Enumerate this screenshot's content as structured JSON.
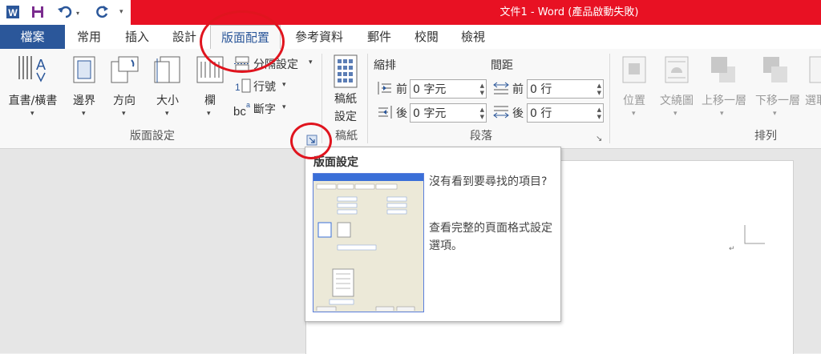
{
  "window": {
    "title": "文件1 - Word (產品啟動失敗)"
  },
  "tabs": [
    "檔案",
    "常用",
    "插入",
    "設計",
    "版面配置",
    "參考資料",
    "郵件",
    "校閱",
    "檢視"
  ],
  "page_setup": {
    "text_direction": "直書/橫書",
    "margins": "邊界",
    "orientation": "方向",
    "size": "大小",
    "columns": "欄",
    "breaks": "分隔設定",
    "line_numbers": "行號",
    "hyphenation": "斷字",
    "group_label": "版面設定"
  },
  "draft": {
    "label_line1": "稿紙",
    "label_line2": "設定",
    "group_label": "稿紙"
  },
  "paragraph": {
    "indent_title": "縮排",
    "spacing_title": "間距",
    "indent_before_label": "前",
    "indent_after_label": "後",
    "indent_before_value": "0 字元",
    "indent_after_value": "0 字元",
    "spacing_before_label": "前",
    "spacing_after_label": "後",
    "spacing_before_value": "0 行",
    "spacing_after_value": "0 行",
    "group_label": "段落"
  },
  "arrange": {
    "position": "位置",
    "wrap_text": "文繞圖",
    "bring_forward": "上移一層",
    "send_backward": "下移一層",
    "selection": "選取",
    "group_label": "排列"
  },
  "tooltip": {
    "title": "版面設定",
    "line1": "沒有看到要尋找的項目?",
    "line2": "查看完整的頁面格式設定選項。"
  },
  "colors": {
    "title_bar": "#e81123",
    "file_tab": "#2b579a",
    "annotation": "#e0141e"
  }
}
